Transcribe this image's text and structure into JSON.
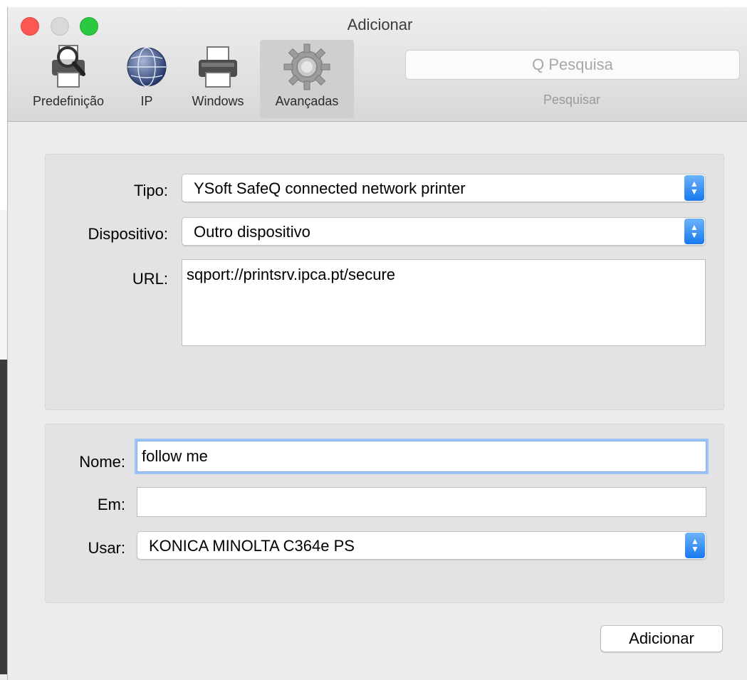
{
  "window": {
    "title": "Adicionar"
  },
  "toolbar": {
    "items": [
      {
        "label": "Predefinição",
        "icon": "printer-magnifier-icon"
      },
      {
        "label": "IP",
        "icon": "globe-icon"
      },
      {
        "label": "Windows",
        "icon": "printer-icon"
      },
      {
        "label": "Avançadas",
        "icon": "gear-icon",
        "selected": true
      }
    ],
    "search": {
      "placeholder": "Q Pesquisa",
      "caption": "Pesquisar"
    }
  },
  "connection": {
    "tipo_label": "Tipo:",
    "tipo_value": "YSoft SafeQ connected network printer",
    "dispositivo_label": "Dispositivo:",
    "dispositivo_value": "Outro dispositivo",
    "url_label": "URL:",
    "url_value": "sqport://printsrv.ipca.pt/secure"
  },
  "details": {
    "nome_label": "Nome:",
    "nome_value": "follow me",
    "em_label": "Em:",
    "em_value": "",
    "usar_label": "Usar:",
    "usar_value": "KONICA MINOLTA C364e PS"
  },
  "footer": {
    "add_button": "Adicionar"
  },
  "colors": {
    "accent": "#1779f0",
    "close": "#fc5753",
    "maximize": "#2bc840"
  }
}
